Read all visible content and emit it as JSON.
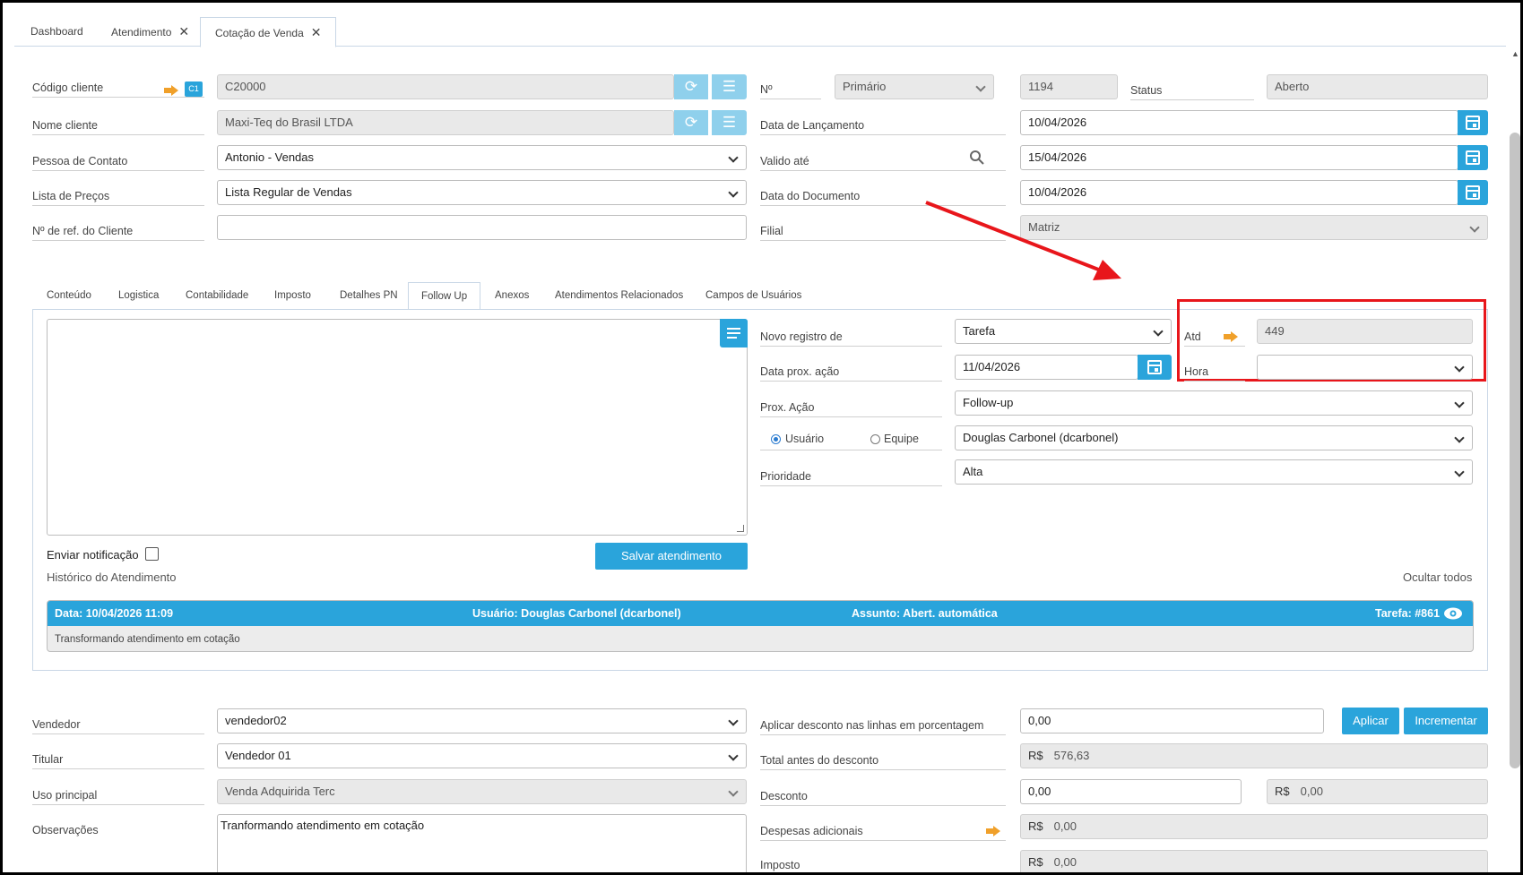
{
  "tabs": {
    "dashboard": "Dashboard",
    "atendimento": "Atendimento",
    "cotacao": "Cotação de Venda"
  },
  "header": {
    "codigo_cliente_label": "Código cliente",
    "c1_badge": "C1",
    "codigo_cliente_value": "C20000",
    "nome_cliente_label": "Nome cliente",
    "nome_cliente_value": "Maxi-Teq do Brasil LTDA",
    "pessoa_contato_label": "Pessoa de Contato",
    "pessoa_contato_value": "Antonio - Vendas",
    "lista_precos_label": "Lista de Preços",
    "lista_precos_value": "Lista Regular de Vendas",
    "ref_cliente_label": "Nº de ref. do Cliente",
    "ref_cliente_value": "",
    "numero_label": "Nº",
    "serie_value": "Primário",
    "numero_value": "1194",
    "status_label": "Status",
    "status_value": "Aberto",
    "data_lancamento_label": "Data de Lançamento",
    "data_lancamento_value": "10/04/2026",
    "valido_ate_label": "Valido até",
    "valido_ate_value": "15/04/2026",
    "data_documento_label": "Data do Documento",
    "data_documento_value": "10/04/2026",
    "filial_label": "Filial",
    "filial_value": "Matriz"
  },
  "subtabs": [
    "Conteúdo",
    "Logistica",
    "Contabilidade",
    "Imposto",
    "Detalhes PN",
    "Follow Up",
    "Anexos",
    "Atendimentos Relacionados",
    "Campos de Usuários"
  ],
  "followup": {
    "novo_registro_label": "Novo registro de",
    "novo_registro_value": "Tarefa",
    "atd_label": "Atd",
    "atd_value": "449",
    "data_prox_label": "Data prox. ação",
    "data_prox_value": "11/04/2026",
    "hora_label": "Hora",
    "hora_value": "",
    "prox_acao_label": "Prox. Ação",
    "prox_acao_value": "Follow-up",
    "usuario_label": "Usuário",
    "equipe_label": "Equipe",
    "usuario_value": "Douglas Carbonel (dcarbonel)",
    "prioridade_label": "Prioridade",
    "prioridade_value": "Alta",
    "enviar_notificacao_label": "Enviar notificação",
    "salvar_label": "Salvar atendimento",
    "historico_label": "Histórico do Atendimento",
    "ocultar_label": "Ocultar todos",
    "history": {
      "data": "Data: 10/04/2026 11:09",
      "usuario": "Usuário: Douglas Carbonel (dcarbonel)",
      "assunto": "Assunto: Abert. automática",
      "tarefa": "Tarefa: #861",
      "texto": "Transformando atendimento em cotação"
    }
  },
  "footer": {
    "vendedor_label": "Vendedor",
    "vendedor_value": "vendedor02",
    "titular_label": "Titular",
    "titular_value": "Vendedor 01",
    "uso_label": "Uso principal",
    "uso_value": "Venda Adquirida Terc",
    "observacoes_label": "Observações",
    "observacoes_value": "Tranformando atendimento em cotação",
    "aplicar_desc_label": "Aplicar desconto nas linhas em porcentagem",
    "aplicar_desc_value": "0,00",
    "aplicar_btn": "Aplicar",
    "incrementar_btn": "Incrementar",
    "total_antes_label": "Total antes do desconto",
    "currency": "R$",
    "total_antes_value": "576,63",
    "desconto_label": "Desconto",
    "desconto_pct_value": "0,00",
    "desconto_valor": "0,00",
    "despesas_label": "Despesas adicionais",
    "despesas_value": "0,00",
    "imposto_label": "Imposto",
    "imposto_value": "0,00"
  },
  "colors": {
    "accent": "#2aa4db",
    "highlight": "#e8161b",
    "arrow": "#f0a02a"
  }
}
